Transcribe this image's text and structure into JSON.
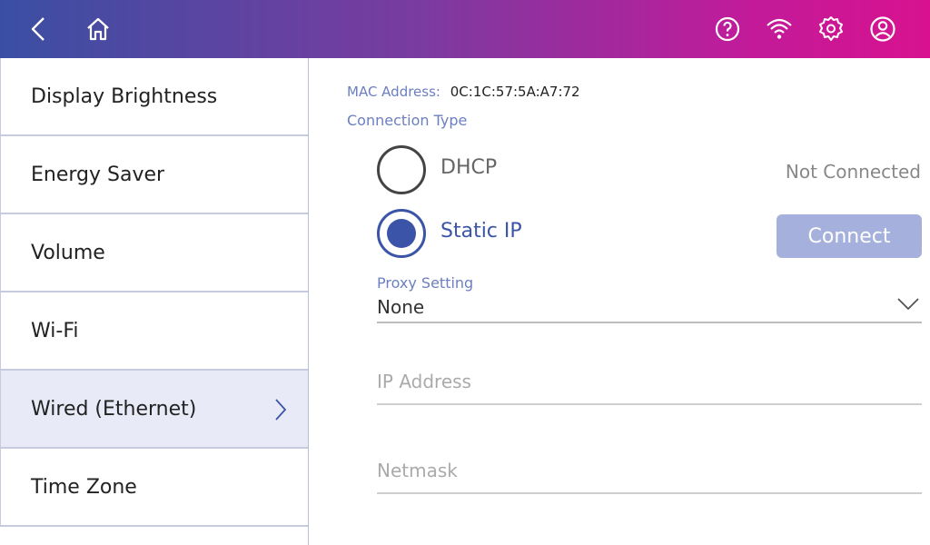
{
  "header": {
    "icons": [
      "back-icon",
      "home-icon",
      "help-icon",
      "wifi-icon",
      "gear-icon",
      "account-icon"
    ]
  },
  "sidebar": {
    "items": [
      {
        "label": "Display Brightness"
      },
      {
        "label": "Energy Saver"
      },
      {
        "label": "Volume"
      },
      {
        "label": "Wi-Fi"
      },
      {
        "label": "Wired (Ethernet)"
      },
      {
        "label": "Time Zone"
      }
    ],
    "active_index": 4
  },
  "main": {
    "mac_label": "MAC Address:",
    "mac_value": "0C:1C:57:5A:A7:72",
    "connection_type_label": "Connection Type",
    "options": [
      {
        "label": "DHCP",
        "selected": false
      },
      {
        "label": "Static IP",
        "selected": true
      }
    ],
    "status": "Not Connected",
    "connect_label": "Connect",
    "proxy_label": "Proxy Setting",
    "proxy_value": "None",
    "ip_placeholder": "IP Address",
    "netmask_placeholder": "Netmask"
  },
  "colors": {
    "accent": "#3b54a8",
    "label": "#6c7fc0",
    "button_disabled": "#a5b1dc"
  }
}
